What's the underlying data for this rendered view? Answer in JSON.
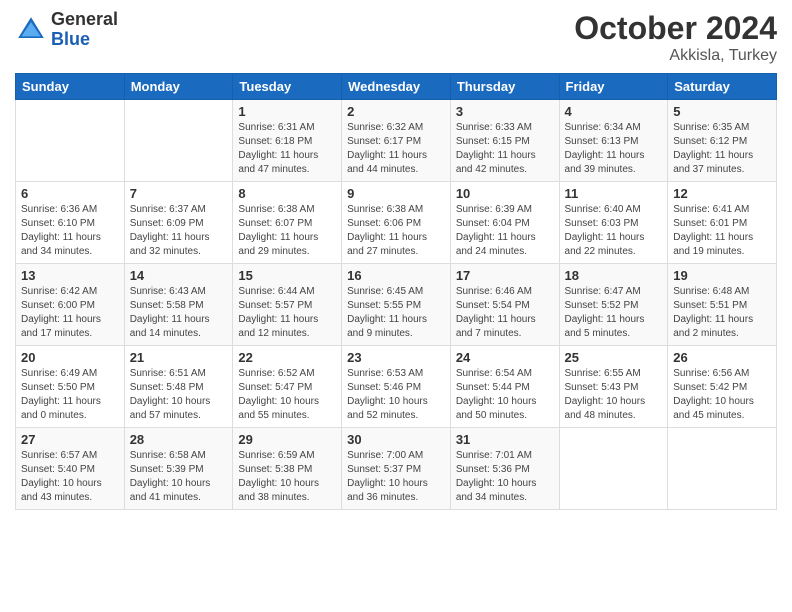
{
  "header": {
    "logo_general": "General",
    "logo_blue": "Blue",
    "month_year": "October 2024",
    "location": "Akkisla, Turkey"
  },
  "days_of_week": [
    "Sunday",
    "Monday",
    "Tuesday",
    "Wednesday",
    "Thursday",
    "Friday",
    "Saturday"
  ],
  "weeks": [
    [
      {
        "day": "",
        "info": ""
      },
      {
        "day": "",
        "info": ""
      },
      {
        "day": "1",
        "info": "Sunrise: 6:31 AM\nSunset: 6:18 PM\nDaylight: 11 hours and 47 minutes."
      },
      {
        "day": "2",
        "info": "Sunrise: 6:32 AM\nSunset: 6:17 PM\nDaylight: 11 hours and 44 minutes."
      },
      {
        "day": "3",
        "info": "Sunrise: 6:33 AM\nSunset: 6:15 PM\nDaylight: 11 hours and 42 minutes."
      },
      {
        "day": "4",
        "info": "Sunrise: 6:34 AM\nSunset: 6:13 PM\nDaylight: 11 hours and 39 minutes."
      },
      {
        "day": "5",
        "info": "Sunrise: 6:35 AM\nSunset: 6:12 PM\nDaylight: 11 hours and 37 minutes."
      }
    ],
    [
      {
        "day": "6",
        "info": "Sunrise: 6:36 AM\nSunset: 6:10 PM\nDaylight: 11 hours and 34 minutes."
      },
      {
        "day": "7",
        "info": "Sunrise: 6:37 AM\nSunset: 6:09 PM\nDaylight: 11 hours and 32 minutes."
      },
      {
        "day": "8",
        "info": "Sunrise: 6:38 AM\nSunset: 6:07 PM\nDaylight: 11 hours and 29 minutes."
      },
      {
        "day": "9",
        "info": "Sunrise: 6:38 AM\nSunset: 6:06 PM\nDaylight: 11 hours and 27 minutes."
      },
      {
        "day": "10",
        "info": "Sunrise: 6:39 AM\nSunset: 6:04 PM\nDaylight: 11 hours and 24 minutes."
      },
      {
        "day": "11",
        "info": "Sunrise: 6:40 AM\nSunset: 6:03 PM\nDaylight: 11 hours and 22 minutes."
      },
      {
        "day": "12",
        "info": "Sunrise: 6:41 AM\nSunset: 6:01 PM\nDaylight: 11 hours and 19 minutes."
      }
    ],
    [
      {
        "day": "13",
        "info": "Sunrise: 6:42 AM\nSunset: 6:00 PM\nDaylight: 11 hours and 17 minutes."
      },
      {
        "day": "14",
        "info": "Sunrise: 6:43 AM\nSunset: 5:58 PM\nDaylight: 11 hours and 14 minutes."
      },
      {
        "day": "15",
        "info": "Sunrise: 6:44 AM\nSunset: 5:57 PM\nDaylight: 11 hours and 12 minutes."
      },
      {
        "day": "16",
        "info": "Sunrise: 6:45 AM\nSunset: 5:55 PM\nDaylight: 11 hours and 9 minutes."
      },
      {
        "day": "17",
        "info": "Sunrise: 6:46 AM\nSunset: 5:54 PM\nDaylight: 11 hours and 7 minutes."
      },
      {
        "day": "18",
        "info": "Sunrise: 6:47 AM\nSunset: 5:52 PM\nDaylight: 11 hours and 5 minutes."
      },
      {
        "day": "19",
        "info": "Sunrise: 6:48 AM\nSunset: 5:51 PM\nDaylight: 11 hours and 2 minutes."
      }
    ],
    [
      {
        "day": "20",
        "info": "Sunrise: 6:49 AM\nSunset: 5:50 PM\nDaylight: 11 hours and 0 minutes."
      },
      {
        "day": "21",
        "info": "Sunrise: 6:51 AM\nSunset: 5:48 PM\nDaylight: 10 hours and 57 minutes."
      },
      {
        "day": "22",
        "info": "Sunrise: 6:52 AM\nSunset: 5:47 PM\nDaylight: 10 hours and 55 minutes."
      },
      {
        "day": "23",
        "info": "Sunrise: 6:53 AM\nSunset: 5:46 PM\nDaylight: 10 hours and 52 minutes."
      },
      {
        "day": "24",
        "info": "Sunrise: 6:54 AM\nSunset: 5:44 PM\nDaylight: 10 hours and 50 minutes."
      },
      {
        "day": "25",
        "info": "Sunrise: 6:55 AM\nSunset: 5:43 PM\nDaylight: 10 hours and 48 minutes."
      },
      {
        "day": "26",
        "info": "Sunrise: 6:56 AM\nSunset: 5:42 PM\nDaylight: 10 hours and 45 minutes."
      }
    ],
    [
      {
        "day": "27",
        "info": "Sunrise: 6:57 AM\nSunset: 5:40 PM\nDaylight: 10 hours and 43 minutes."
      },
      {
        "day": "28",
        "info": "Sunrise: 6:58 AM\nSunset: 5:39 PM\nDaylight: 10 hours and 41 minutes."
      },
      {
        "day": "29",
        "info": "Sunrise: 6:59 AM\nSunset: 5:38 PM\nDaylight: 10 hours and 38 minutes."
      },
      {
        "day": "30",
        "info": "Sunrise: 7:00 AM\nSunset: 5:37 PM\nDaylight: 10 hours and 36 minutes."
      },
      {
        "day": "31",
        "info": "Sunrise: 7:01 AM\nSunset: 5:36 PM\nDaylight: 10 hours and 34 minutes."
      },
      {
        "day": "",
        "info": ""
      },
      {
        "day": "",
        "info": ""
      }
    ]
  ]
}
